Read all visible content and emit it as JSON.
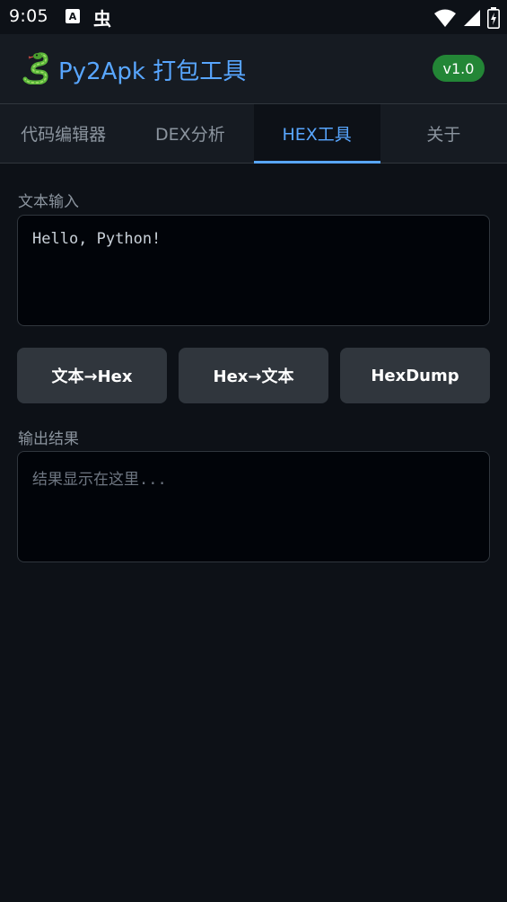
{
  "status_bar": {
    "time": "9:05",
    "notif_a": "A",
    "notif_bug": "虫"
  },
  "header": {
    "logo_icon": "snake-icon",
    "title": "Py2Apk 打包工具",
    "version": "v1.0"
  },
  "tabs": [
    {
      "label": "代码编辑器",
      "active": false
    },
    {
      "label": "DEX分析",
      "active": false
    },
    {
      "label": "HEX工具",
      "active": true
    },
    {
      "label": "关于",
      "active": false
    }
  ],
  "input": {
    "label": "文本输入",
    "value": "Hello, Python!"
  },
  "buttons": {
    "text_to_hex": "文本→Hex",
    "hex_to_text": "Hex→文本",
    "hexdump": "HexDump"
  },
  "output": {
    "label": "输出结果",
    "placeholder": "结果显示在这里..."
  },
  "colors": {
    "background": "#0d1117",
    "accent": "#58a6ff",
    "badge": "#238636"
  }
}
